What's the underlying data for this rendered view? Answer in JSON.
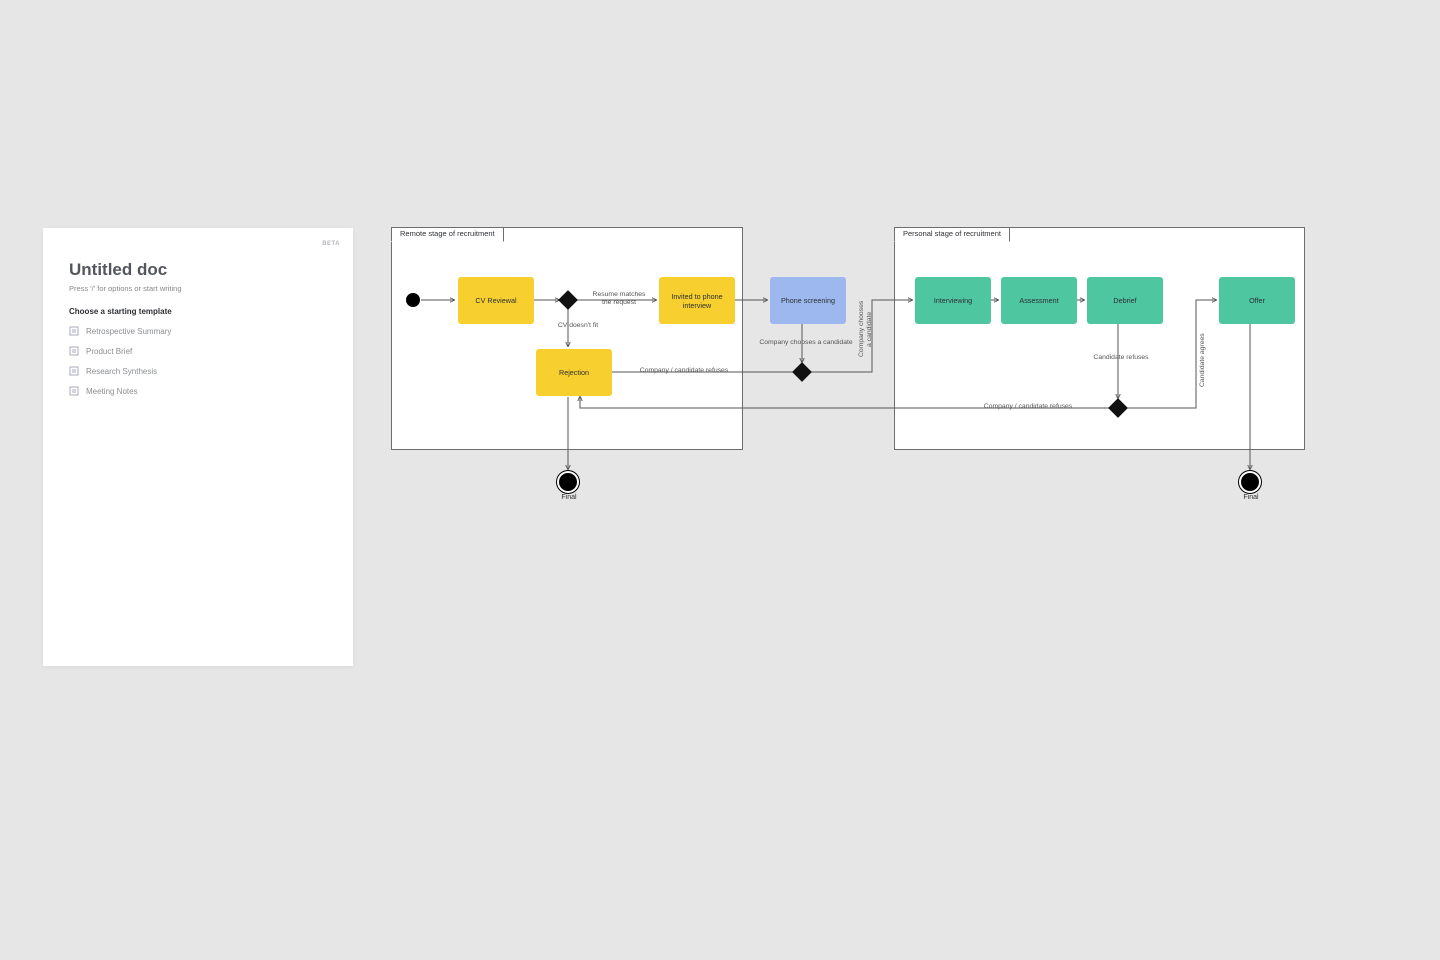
{
  "doc": {
    "badge": "BETA",
    "title": "Untitled doc",
    "hint": "Press '/' for options or start writing",
    "template_header": "Choose a starting template",
    "templates": [
      {
        "label": "Retrospective Summary"
      },
      {
        "label": "Product Brief"
      },
      {
        "label": "Research Synthesis"
      },
      {
        "label": "Meeting Notes"
      }
    ]
  },
  "stages": {
    "remote": "Remote stage of recruitment",
    "personal": "Personal stage of recruitment"
  },
  "nodes": {
    "cv_reviewal": "CV Reviewal",
    "invited": "Invited to phone interview",
    "phone_screening": "Phone screening",
    "rejection": "Rejection",
    "interviewing": "Interviewing",
    "assessment": "Assessment",
    "debrief": "Debrief",
    "offer": "Offer"
  },
  "edge_labels": {
    "resume_matches": "Resume matches\nthe request",
    "cv_doesnt_fit": "CV doesn't fit",
    "company_candidate_refuses": "Company / candidate refuses",
    "company_chooses": "Company chooses a candidate",
    "company_chooses_vert": "Company chooses\na candidate",
    "candidate_refuses": "Candidate refuses",
    "candidate_agrees": "Candidate agrees"
  },
  "final_label": "Final",
  "colors": {
    "yellow": "#f7cf2e",
    "blue": "#9cb8ee",
    "green": "#4ec6a0",
    "bg": "#e6e6e6"
  }
}
